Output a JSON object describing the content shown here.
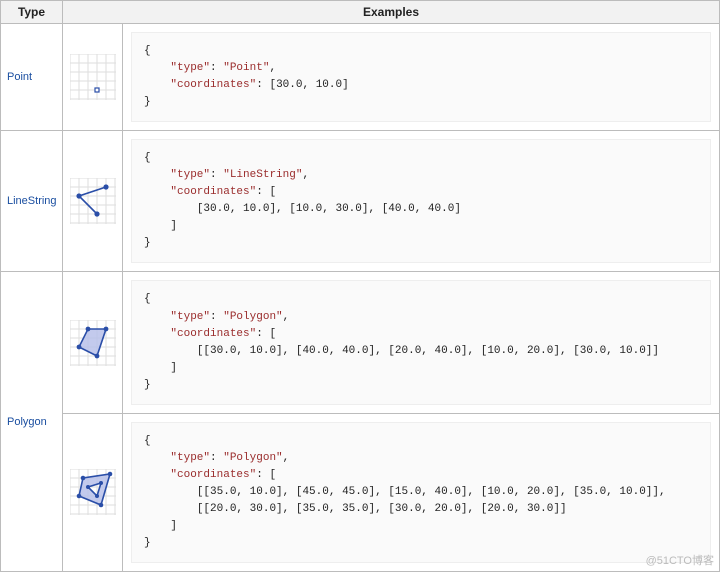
{
  "headers": {
    "type": "Type",
    "examples": "Examples"
  },
  "rows": [
    {
      "type_label": "Point",
      "examples": [
        {
          "geojson": {
            "type": "Point",
            "coordinates": [
              30.0,
              10.0
            ]
          },
          "code_lines": [
            "{",
            "    \"type\": \"Point\",",
            "    \"coordinates\": [30.0, 10.0]",
            "}"
          ]
        }
      ]
    },
    {
      "type_label": "LineString",
      "examples": [
        {
          "geojson": {
            "type": "LineString",
            "coordinates": [
              [
                30.0,
                10.0
              ],
              [
                10.0,
                30.0
              ],
              [
                40.0,
                40.0
              ]
            ]
          },
          "code_lines": [
            "{",
            "    \"type\": \"LineString\",",
            "    \"coordinates\": [",
            "        [30.0, 10.0], [10.0, 30.0], [40.0, 40.0]",
            "    ]",
            "}"
          ]
        }
      ]
    },
    {
      "type_label": "Polygon",
      "examples": [
        {
          "geojson": {
            "type": "Polygon",
            "coordinates": [
              [
                [
                  30.0,
                  10.0
                ],
                [
                  40.0,
                  40.0
                ],
                [
                  20.0,
                  40.0
                ],
                [
                  10.0,
                  20.0
                ],
                [
                  30.0,
                  10.0
                ]
              ]
            ]
          },
          "code_lines": [
            "{",
            "    \"type\": \"Polygon\",",
            "    \"coordinates\": [",
            "        [[30.0, 10.0], [40.0, 40.0], [20.0, 40.0], [10.0, 20.0], [30.0, 10.0]]",
            "    ]",
            "}"
          ]
        },
        {
          "geojson": {
            "type": "Polygon",
            "coordinates": [
              [
                [
                  35.0,
                  10.0
                ],
                [
                  45.0,
                  45.0
                ],
                [
                  15.0,
                  40.0
                ],
                [
                  10.0,
                  20.0
                ],
                [
                  35.0,
                  10.0
                ]
              ],
              [
                [
                  20.0,
                  30.0
                ],
                [
                  35.0,
                  35.0
                ],
                [
                  30.0,
                  20.0
                ],
                [
                  20.0,
                  30.0
                ]
              ]
            ]
          },
          "code_lines": [
            "{",
            "    \"type\": \"Polygon\",",
            "    \"coordinates\": [",
            "        [[35.0, 10.0], [45.0, 45.0], [15.0, 40.0], [10.0, 20.0], [35.0, 10.0]],",
            "        [[20.0, 30.0], [35.0, 35.0], [30.0, 20.0], [20.0, 30.0]]",
            "    ]",
            "}"
          ]
        }
      ]
    }
  ],
  "watermark": "@51CTO博客"
}
